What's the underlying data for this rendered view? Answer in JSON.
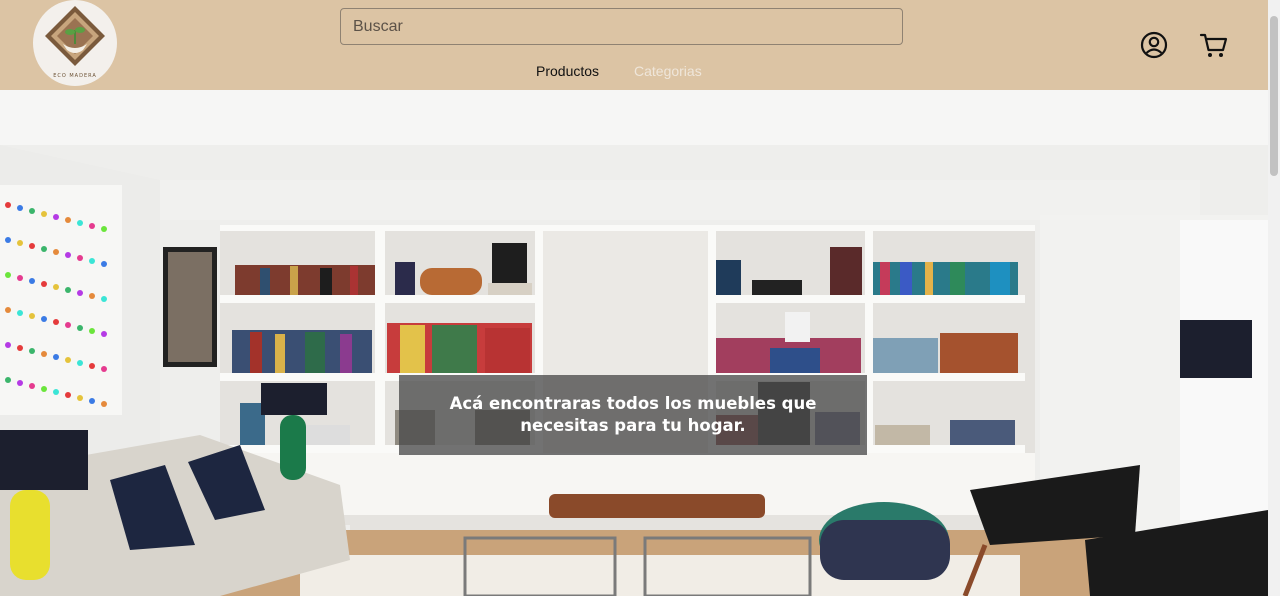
{
  "brand": {
    "name": "ECO MADERA"
  },
  "header": {
    "search": {
      "placeholder": "Buscar",
      "value": ""
    },
    "nav": [
      {
        "label": "Productos",
        "active": true
      },
      {
        "label": "Categorias",
        "active": false
      }
    ],
    "icons": {
      "account": "user-circle-icon",
      "cart": "shopping-cart-icon"
    }
  },
  "hero": {
    "caption": "Acá encontraras todos los muebles que necesitas para tu hogar."
  },
  "colors": {
    "header_bg": "#dcc4a4",
    "logo_bg": "#f3f0ec",
    "nav_active": "#111111",
    "nav_inactive": "#efe6da",
    "caption_bg": "#4b4b4b"
  }
}
